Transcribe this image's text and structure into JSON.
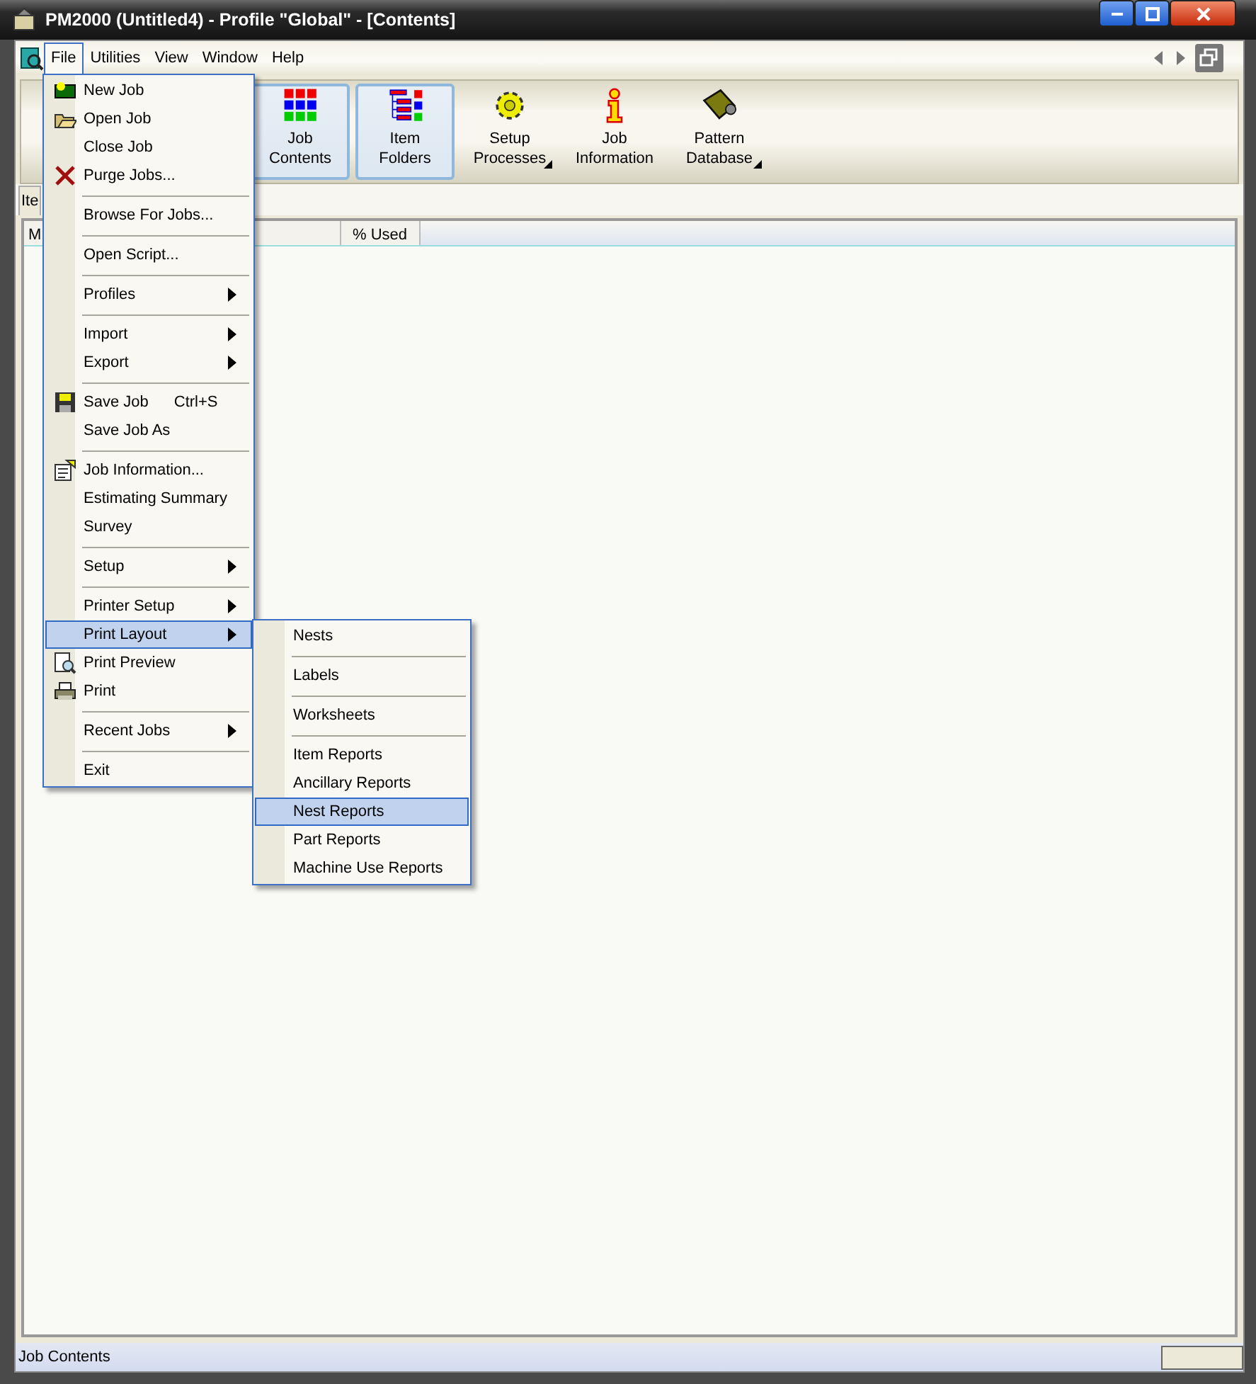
{
  "window": {
    "title": "PM2000 (Untitled4) - Profile \"Global\" - [Contents]"
  },
  "menubar": [
    {
      "label": "File",
      "selected": true
    },
    {
      "label": "Utilities",
      "selected": false
    },
    {
      "label": "View",
      "selected": false
    },
    {
      "label": "Window",
      "selected": false
    },
    {
      "label": "Help",
      "selected": false
    }
  ],
  "toolbar": [
    {
      "label": "Job Contents",
      "active": true,
      "dropdown": false
    },
    {
      "label": "Item Folders",
      "active": true,
      "dropdown": false
    },
    {
      "label": "Setup Processes",
      "active": false,
      "dropdown": true
    },
    {
      "label": "Job Information",
      "active": false,
      "dropdown": false
    },
    {
      "label": "Pattern Database",
      "active": false,
      "dropdown": true
    }
  ],
  "tab": {
    "label": "Ite"
  },
  "list": {
    "columns": [
      "M",
      "% Used"
    ]
  },
  "file_menu": [
    {
      "kind": "item",
      "label": "New Job",
      "submenu": false,
      "selected": false
    },
    {
      "kind": "item",
      "label": "Open Job",
      "submenu": false,
      "selected": false
    },
    {
      "kind": "item",
      "label": "Close Job",
      "submenu": false,
      "selected": false
    },
    {
      "kind": "item",
      "label": "Purge Jobs...",
      "submenu": false,
      "selected": false
    },
    {
      "kind": "separator"
    },
    {
      "kind": "item",
      "label": "Browse For Jobs...",
      "submenu": false,
      "selected": false
    },
    {
      "kind": "separator"
    },
    {
      "kind": "item",
      "label": "Open Script...",
      "submenu": false,
      "selected": false
    },
    {
      "kind": "separator"
    },
    {
      "kind": "item",
      "label": "Profiles",
      "submenu": true,
      "selected": false
    },
    {
      "kind": "separator"
    },
    {
      "kind": "item",
      "label": "Import",
      "submenu": true,
      "selected": false
    },
    {
      "kind": "item",
      "label": "Export",
      "submenu": true,
      "selected": false
    },
    {
      "kind": "separator"
    },
    {
      "kind": "item",
      "label": "Save Job",
      "shortcut": "Ctrl+S",
      "submenu": false,
      "selected": false
    },
    {
      "kind": "item",
      "label": "Save Job As",
      "submenu": false,
      "selected": false
    },
    {
      "kind": "separator"
    },
    {
      "kind": "item",
      "label": "Job Information...",
      "submenu": false,
      "selected": false
    },
    {
      "kind": "item",
      "label": "Estimating Summary",
      "submenu": false,
      "selected": false
    },
    {
      "kind": "item",
      "label": "Survey",
      "submenu": false,
      "selected": false
    },
    {
      "kind": "separator"
    },
    {
      "kind": "item",
      "label": "Setup",
      "submenu": true,
      "selected": false
    },
    {
      "kind": "separator"
    },
    {
      "kind": "item",
      "label": "Printer Setup",
      "submenu": true,
      "selected": false
    },
    {
      "kind": "item",
      "label": "Print Layout",
      "submenu": true,
      "selected": true
    },
    {
      "kind": "item",
      "label": "Print Preview",
      "submenu": false,
      "selected": false
    },
    {
      "kind": "item",
      "label": "Print",
      "submenu": false,
      "selected": false
    },
    {
      "kind": "separator"
    },
    {
      "kind": "item",
      "label": "Recent Jobs",
      "submenu": true,
      "selected": false
    },
    {
      "kind": "separator"
    },
    {
      "kind": "item",
      "label": "Exit",
      "submenu": false,
      "selected": false
    }
  ],
  "print_layout_menu": [
    {
      "kind": "item",
      "label": "Nests",
      "selected": false
    },
    {
      "kind": "separator"
    },
    {
      "kind": "item",
      "label": "Labels",
      "selected": false
    },
    {
      "kind": "separator"
    },
    {
      "kind": "item",
      "label": "Worksheets",
      "selected": false
    },
    {
      "kind": "separator"
    },
    {
      "kind": "item",
      "label": "Item Reports",
      "selected": false
    },
    {
      "kind": "item",
      "label": "Ancillary Reports",
      "selected": false
    },
    {
      "kind": "item",
      "label": "Nest Reports",
      "selected": true
    },
    {
      "kind": "item",
      "label": "Part Reports",
      "selected": false
    },
    {
      "kind": "item",
      "label": "Machine Use Reports",
      "selected": false
    }
  ],
  "status_bar": {
    "text": "Job Contents"
  }
}
